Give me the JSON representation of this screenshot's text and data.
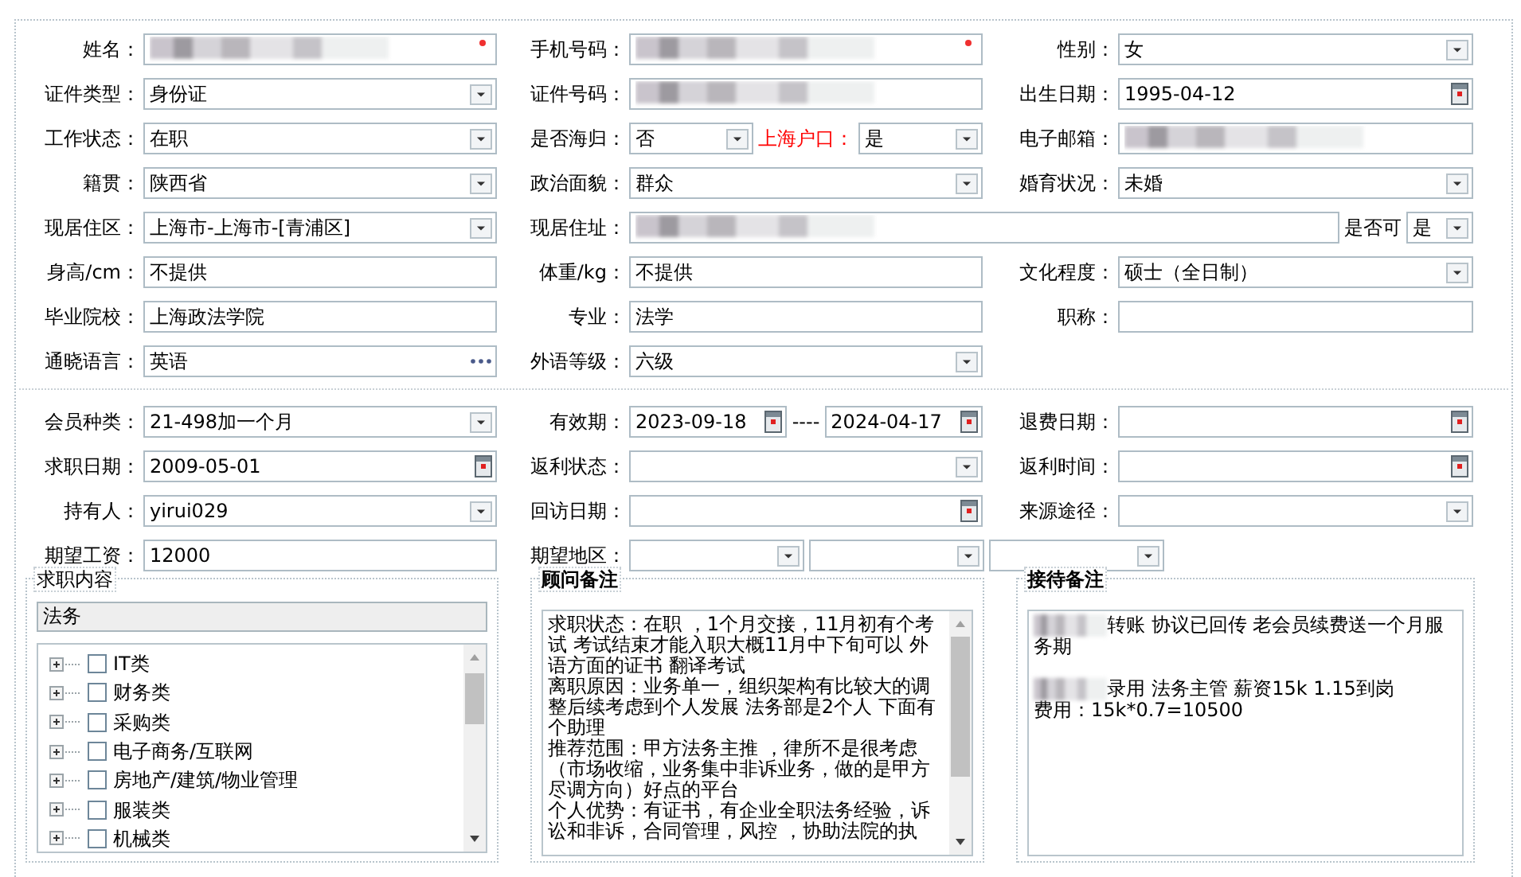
{
  "personal": {
    "rows": [
      [
        {
          "label": "姓名：",
          "controls": [
            {
              "kind": "text",
              "redacted": true,
              "required": true
            }
          ]
        },
        {
          "label": "手机号码：",
          "controls": [
            {
              "kind": "text",
              "redacted": true,
              "required": true
            }
          ]
        },
        {
          "label": "性别：",
          "controls": [
            {
              "kind": "select",
              "value": "女"
            }
          ]
        }
      ],
      [
        {
          "label": "证件类型：",
          "controls": [
            {
              "kind": "select",
              "value": "身份证"
            }
          ]
        },
        {
          "label": "证件号码：",
          "controls": [
            {
              "kind": "text",
              "redacted": true
            }
          ]
        },
        {
          "label": "出生日期：",
          "controls": [
            {
              "kind": "date",
              "value": "1995-04-12"
            }
          ]
        }
      ],
      [
        {
          "label": "工作状态：",
          "controls": [
            {
              "kind": "select",
              "value": "在职"
            }
          ]
        },
        {
          "label": "是否海归：",
          "controls": [
            {
              "kind": "select",
              "value": "否"
            },
            {
              "kind": "label",
              "text": "上海户口：",
              "color": "#ff0000"
            },
            {
              "kind": "select",
              "value": "是"
            }
          ]
        },
        {
          "label": "电子邮箱：",
          "controls": [
            {
              "kind": "text",
              "redacted": true
            }
          ]
        }
      ],
      [
        {
          "label": "籍贯：",
          "controls": [
            {
              "kind": "select",
              "value": "陕西省"
            }
          ]
        },
        {
          "label": "政治面貌：",
          "controls": [
            {
              "kind": "select",
              "value": "群众"
            }
          ]
        },
        {
          "label": "婚育状况：",
          "controls": [
            {
              "kind": "select",
              "value": "未婚"
            }
          ]
        }
      ],
      [
        {
          "label": "现居住区：",
          "controls": [
            {
              "kind": "select",
              "value": "上海市-上海市-[青浦区]"
            }
          ]
        },
        {
          "label": "现居住址：",
          "wide": true,
          "controls": [
            {
              "kind": "text",
              "redacted": true
            },
            {
              "kind": "label",
              "text": "是否可"
            },
            {
              "kind": "select",
              "value": "是"
            }
          ]
        }
      ],
      [
        {
          "label": "身高/cm：",
          "controls": [
            {
              "kind": "text",
              "value": "不提供"
            }
          ]
        },
        {
          "label": "体重/kg：",
          "controls": [
            {
              "kind": "text",
              "value": "不提供"
            }
          ]
        },
        {
          "label": "文化程度：",
          "controls": [
            {
              "kind": "select",
              "value": "硕士（全日制）"
            }
          ]
        }
      ],
      [
        {
          "label": "毕业院校：",
          "controls": [
            {
              "kind": "text",
              "value": "上海政法学院"
            }
          ]
        },
        {
          "label": "专业：",
          "controls": [
            {
              "kind": "text",
              "value": "法学"
            }
          ]
        },
        {
          "label": "职称：",
          "controls": [
            {
              "kind": "text"
            }
          ]
        }
      ],
      [
        {
          "label": "通晓语言：",
          "controls": [
            {
              "kind": "lookup",
              "value": "英语"
            }
          ]
        },
        {
          "label": "外语等级：",
          "controls": [
            {
              "kind": "select",
              "value": "六级"
            }
          ]
        }
      ]
    ]
  },
  "membership": {
    "rows": [
      [
        {
          "label": "会员种类：",
          "controls": [
            {
              "kind": "select",
              "value": "21-498加一个月"
            }
          ]
        },
        {
          "label": "有效期：",
          "controls": [
            {
              "kind": "date",
              "value": "2023-09-18"
            },
            {
              "kind": "label",
              "text": "----"
            },
            {
              "kind": "date",
              "value": "2024-04-17"
            }
          ]
        },
        {
          "label": "退费日期：",
          "controls": [
            {
              "kind": "date"
            }
          ]
        }
      ],
      [
        {
          "label": "求职日期：",
          "controls": [
            {
              "kind": "date",
              "value": "2009-05-01"
            }
          ]
        },
        {
          "label": "返利状态：",
          "controls": [
            {
              "kind": "select"
            }
          ]
        },
        {
          "label": "返利时间：",
          "controls": [
            {
              "kind": "date"
            }
          ]
        }
      ],
      [
        {
          "label": "持有人：",
          "controls": [
            {
              "kind": "select",
              "value": "yirui029"
            }
          ]
        },
        {
          "label": "回访日期：",
          "controls": [
            {
              "kind": "date"
            }
          ]
        },
        {
          "label": "来源途径：",
          "controls": [
            {
              "kind": "select"
            }
          ]
        }
      ],
      [
        {
          "label": "期望工资：",
          "controls": [
            {
              "kind": "text",
              "value": "12000"
            }
          ]
        },
        {
          "label": "期望地区：",
          "wide": true,
          "controls": [
            {
              "kind": "select"
            },
            {
              "kind": "select"
            },
            {
              "kind": "select"
            }
          ]
        }
      ]
    ]
  },
  "panels": [
    {
      "kind": "tree",
      "title": "求职内容",
      "search": {
        "value": "法务"
      },
      "items": [
        {
          "label": "IT类",
          "expanded": false,
          "checked": false
        },
        {
          "label": "财务类",
          "expanded": false,
          "checked": false
        },
        {
          "label": "采购类",
          "expanded": false,
          "checked": false
        },
        {
          "label": "电子商务/互联网",
          "expanded": false,
          "checked": false
        },
        {
          "label": "房地产/建筑/物业管理",
          "expanded": false,
          "checked": false
        },
        {
          "label": "服装类",
          "expanded": false,
          "checked": false
        },
        {
          "label": "机械类",
          "expanded": false,
          "checked": false
        }
      ]
    },
    {
      "kind": "notes",
      "title": "顾问备注",
      "scrollable": true,
      "paragraphs": [
        {
          "text": "求职状态：在职 ，1个月交接，11月初有个考试 考试结束才能入职大概11月中下旬可以 外语方面的证书 翻译考试"
        },
        {
          "text": "离职原因：业务单一，组织架构有比较大的调整后续考虑到个人发展 法务部是2个人 下面有个助理"
        },
        {
          "text": "推荐范围：甲方法务主推 ，律所不是很考虑（市场收缩，业务集中非诉业务，做的是甲方尽调方向）好点的平台"
        },
        {
          "text": "个人优势：有证书，有企业全职法务经验，诉讼和非诉，合同管理，风控 ，协助法院的执"
        }
      ]
    },
    {
      "kind": "notes",
      "title": "接待备注",
      "paragraphs": [
        {
          "text": "转账 协议已回传 老会员续费送一个月服务期",
          "redacted_prefix": true
        },
        {
          "text": "录用 法务主管 薪资15k 1.15到岗",
          "redacted_prefix": true,
          "spaced": true
        },
        {
          "text": "费用：15k*0.7=10500"
        }
      ]
    }
  ]
}
